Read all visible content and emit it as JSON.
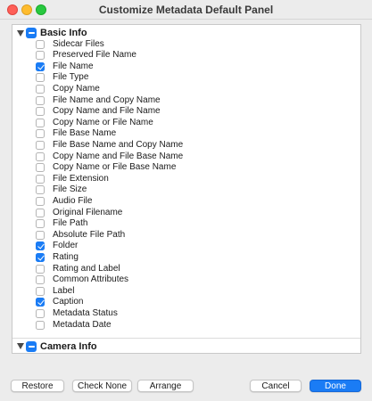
{
  "window": {
    "title": "Customize Metadata Default Panel"
  },
  "colors": {
    "accent": "#1a7cf5",
    "close": "#fe5f57",
    "minimize": "#febc2e",
    "maximize": "#28c840"
  },
  "sections": [
    {
      "label": "Basic Info",
      "state": "mixed",
      "items": [
        {
          "label": "Sidecar Files",
          "checked": false
        },
        {
          "label": "Preserved File Name",
          "checked": false
        },
        {
          "label": "File Name",
          "checked": true
        },
        {
          "label": "File Type",
          "checked": false
        },
        {
          "label": "Copy Name",
          "checked": false
        },
        {
          "label": "File Name and Copy Name",
          "checked": false
        },
        {
          "label": "Copy Name and File Name",
          "checked": false
        },
        {
          "label": "Copy Name or File Name",
          "checked": false
        },
        {
          "label": "File Base Name",
          "checked": false
        },
        {
          "label": "File Base Name and Copy Name",
          "checked": false
        },
        {
          "label": "Copy Name and File Base Name",
          "checked": false
        },
        {
          "label": "Copy Name or File Base Name",
          "checked": false
        },
        {
          "label": "File Extension",
          "checked": false
        },
        {
          "label": "File Size",
          "checked": false
        },
        {
          "label": "Audio File",
          "checked": false
        },
        {
          "label": "Original Filename",
          "checked": false
        },
        {
          "label": "File Path",
          "checked": false
        },
        {
          "label": "Absolute File Path",
          "checked": false
        },
        {
          "label": "Folder",
          "checked": true
        },
        {
          "label": "Rating",
          "checked": true
        },
        {
          "label": "Rating and Label",
          "checked": false
        },
        {
          "label": "Common Attributes",
          "checked": false
        },
        {
          "label": "Label",
          "checked": false
        },
        {
          "label": "Caption",
          "checked": true
        },
        {
          "label": "Metadata Status",
          "checked": false
        },
        {
          "label": "Metadata Date",
          "checked": false
        }
      ]
    },
    {
      "label": "Camera Info",
      "state": "mixed",
      "items": []
    }
  ],
  "buttons": {
    "restore": "Restore",
    "check_none": "Check None",
    "arrange": "Arrange",
    "cancel": "Cancel",
    "done": "Done"
  }
}
